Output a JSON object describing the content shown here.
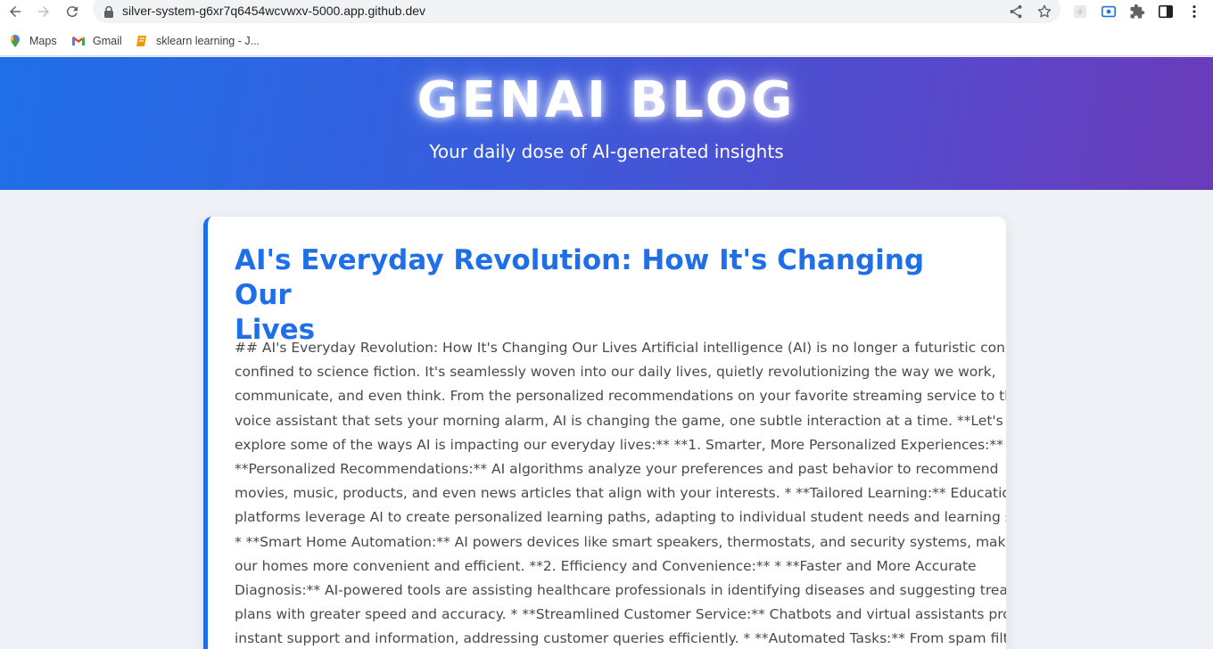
{
  "browser": {
    "url": "silver-system-g6xr7q6454wcvwxv-5000.app.github.dev",
    "bookmarks": [
      {
        "label": "Maps",
        "icon": "maps-icon"
      },
      {
        "label": "Gmail",
        "icon": "gmail-icon"
      },
      {
        "label": "sklearn learning - J...",
        "icon": "book-icon"
      }
    ]
  },
  "header": {
    "title": "GENAI BLOG",
    "subtitle": "Your daily dose of AI-generated insights"
  },
  "post": {
    "title_lines": [
      "AI's Everyday Revolution: How It's Changing Our",
      "Lives"
    ],
    "body_lines": [
      "## AI's Everyday Revolution: How It's Changing Our Lives Artificial intelligence (AI) is no longer a futuristic concept",
      "confined to science fiction. It's seamlessly woven into our daily lives, quietly revolutionizing the way we work,",
      "communicate, and even think. From the personalized recommendations on your favorite streaming service to the",
      "voice assistant that sets your morning alarm, AI is changing the game, one subtle interaction at a time. **Let's",
      "explore some of the ways AI is impacting our everyday lives:** **1. Smarter, More Personalized Experiences:** *",
      "**Personalized Recommendations:** AI algorithms analyze your preferences and past behavior to recommend",
      "movies, music, products, and even news articles that align with your interests. * **Tailored Learning:** Educational",
      "platforms leverage AI to create personalized learning paths, adapting to individual student needs and learning styles.",
      "* **Smart Home Automation:** AI powers devices like smart speakers, thermostats, and security systems, making",
      "our homes more convenient and efficient. **2. Efficiency and Convenience:** * **Faster and More Accurate",
      "Diagnosis:** AI-powered tools are assisting healthcare professionals in identifying diseases and suggesting treatment",
      "plans with greater speed and accuracy. * **Streamlined Customer Service:** Chatbots and virtual assistants provide",
      "instant support and information, addressing customer queries efficiently. * **Automated Tasks:** From spam filtering"
    ]
  },
  "colors": {
    "accent": "#1f6fe8",
    "gradient_start": "#1f6fe8",
    "gradient_end": "#6a3bb8",
    "page_bg": "#eef1f6"
  }
}
